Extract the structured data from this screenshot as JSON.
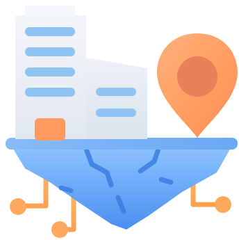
{
  "illustration": {
    "subject": [
      "building-icon",
      "location-pin-icon",
      "floating-island-icon",
      "circuit-network-icon"
    ],
    "colors": {
      "building_main": "#eef2f7",
      "building_side": "#e3e9f1",
      "window_stripe": "#8ec3f2",
      "door": "#ff9a5c",
      "pin_outer": "#ff9a5c",
      "pin_inner": "#e8805a",
      "island_top": "#7fb6f5",
      "island_body_light": "#8cc2ff",
      "island_body_dark": "#4a90f0",
      "island_cracks": "#3c7fe0",
      "circuit": "#ffb266"
    }
  }
}
